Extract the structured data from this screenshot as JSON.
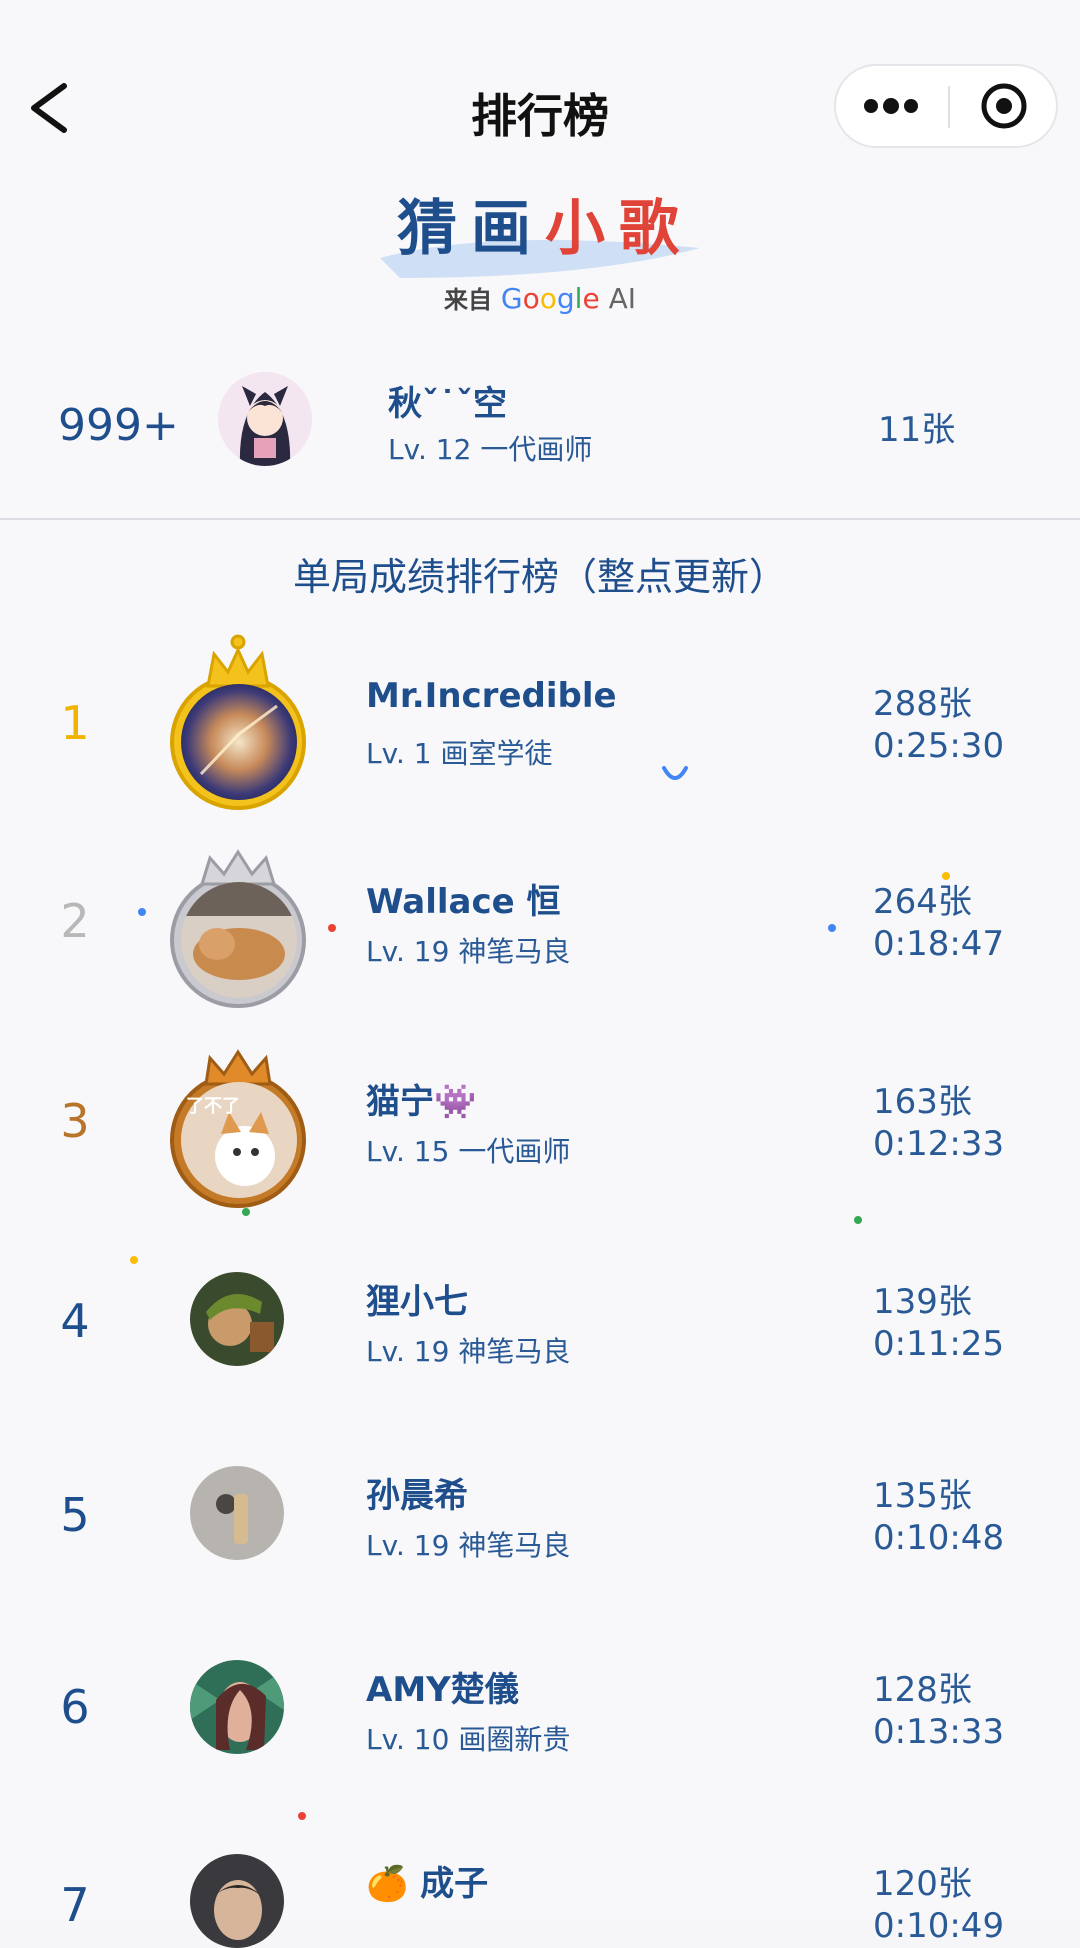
{
  "nav": {
    "back_icon": "chevron-left-icon",
    "title": "排行榜",
    "more_icon": "more-dots-icon",
    "close_icon": "target-circle-icon"
  },
  "logo": {
    "title_chars": [
      "猜",
      "画",
      "小",
      "歌"
    ],
    "from": "来自",
    "google_letters": [
      "G",
      "o",
      "o",
      "g",
      "l",
      "e"
    ],
    "ai": "AI",
    "colors": {
      "blue": "#1f4e8c",
      "red": "#e04438"
    }
  },
  "me": {
    "rank": "999+",
    "name": "秋ˇ˙ˇ",
    "name_end": "空",
    "level": "Lv. 12 一代画师",
    "count": "11张"
  },
  "section_title": "单局成绩排行榜（整点更新）",
  "leaderboard": [
    {
      "rank": "1",
      "name": "Mr.Incredible",
      "level": "Lv. 1 画室学徒",
      "count": "288张",
      "time": "0:25:30",
      "rank_color": "#f0b400",
      "frame": "gold-crown"
    },
    {
      "rank": "2",
      "name": "Wallace 恒",
      "level": "Lv. 19 神笔马良",
      "count": "264张",
      "time": "0:18:47",
      "rank_color": "#b8b8b8",
      "frame": "silver-crown"
    },
    {
      "rank": "3",
      "name": "猫宁👾",
      "level": "Lv. 15 一代画师",
      "count": "163张",
      "time": "0:12:33",
      "rank_color": "#b8742a",
      "frame": "bronze-crown"
    },
    {
      "rank": "4",
      "name": "狸小七",
      "level": "Lv. 19 神笔马良",
      "count": "139张",
      "time": "0:11:25",
      "rank_color": "#1f4e8c",
      "frame": "none"
    },
    {
      "rank": "5",
      "name": "孙晨希",
      "level": "Lv. 19 神笔马良",
      "count": "135张",
      "time": "0:10:48",
      "rank_color": "#1f4e8c",
      "frame": "none"
    },
    {
      "rank": "6",
      "name": "AMY楚儀",
      "level": "Lv. 10 画圈新贵",
      "count": "128张",
      "time": "0:13:33",
      "rank_color": "#1f4e8c",
      "frame": "none"
    },
    {
      "rank": "7",
      "name": "🍊 成子",
      "level": "",
      "count": "120张",
      "time": "0:10:49",
      "rank_color": "#1f4e8c",
      "frame": "none"
    }
  ],
  "frame_text_3": "了不了"
}
